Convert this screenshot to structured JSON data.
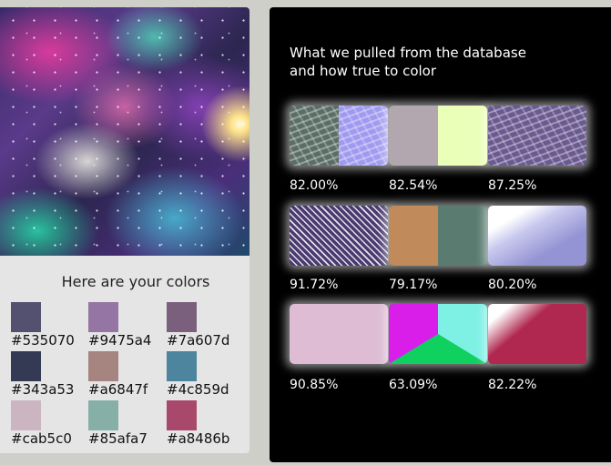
{
  "left": {
    "title": "Here are your colors",
    "swatches": [
      {
        "hex": "#535070",
        "label": "#535070"
      },
      {
        "hex": "#9475a4",
        "label": "#9475a4"
      },
      {
        "hex": "#7a607d",
        "label": "#7a607d"
      },
      {
        "hex": "#343a53",
        "label": "#343a53"
      },
      {
        "hex": "#a6847f",
        "label": "#a6847f"
      },
      {
        "hex": "#4c859d",
        "label": "#4c859d"
      },
      {
        "hex": "#cab5c0",
        "label": "#cab5c0"
      },
      {
        "hex": "#85afa7",
        "label": "#85afa7"
      },
      {
        "hex": "#a8486b",
        "label": "#a8486b"
      }
    ]
  },
  "right": {
    "heading_line1": "What we pulled from the database",
    "heading_line2": "and how true to color",
    "tiles": [
      {
        "percent": "82.00%",
        "colors": [
          "#5b6e66",
          "#9f9af0"
        ]
      },
      {
        "percent": "82.54%",
        "colors": [
          "#b2a7ae",
          "#eaffb8"
        ]
      },
      {
        "percent": "87.25%",
        "colors": [
          "#6a5a90"
        ]
      },
      {
        "percent": "91.72%",
        "colors": [
          "#4a3a70",
          "#e8e4f8"
        ]
      },
      {
        "percent": "79.17%",
        "colors": [
          "#c08a5a",
          "#5a7c70"
        ]
      },
      {
        "percent": "80.20%",
        "colors": [
          "#9494d4",
          "#ffffff"
        ]
      },
      {
        "percent": "90.85%",
        "colors": [
          "#ddbcd4"
        ]
      },
      {
        "percent": "63.09%",
        "colors": [
          "#d81ee8",
          "#7ef0e4",
          "#10d060"
        ]
      },
      {
        "percent": "82.22%",
        "colors": [
          "#b02850",
          "#ffffff"
        ]
      }
    ]
  }
}
